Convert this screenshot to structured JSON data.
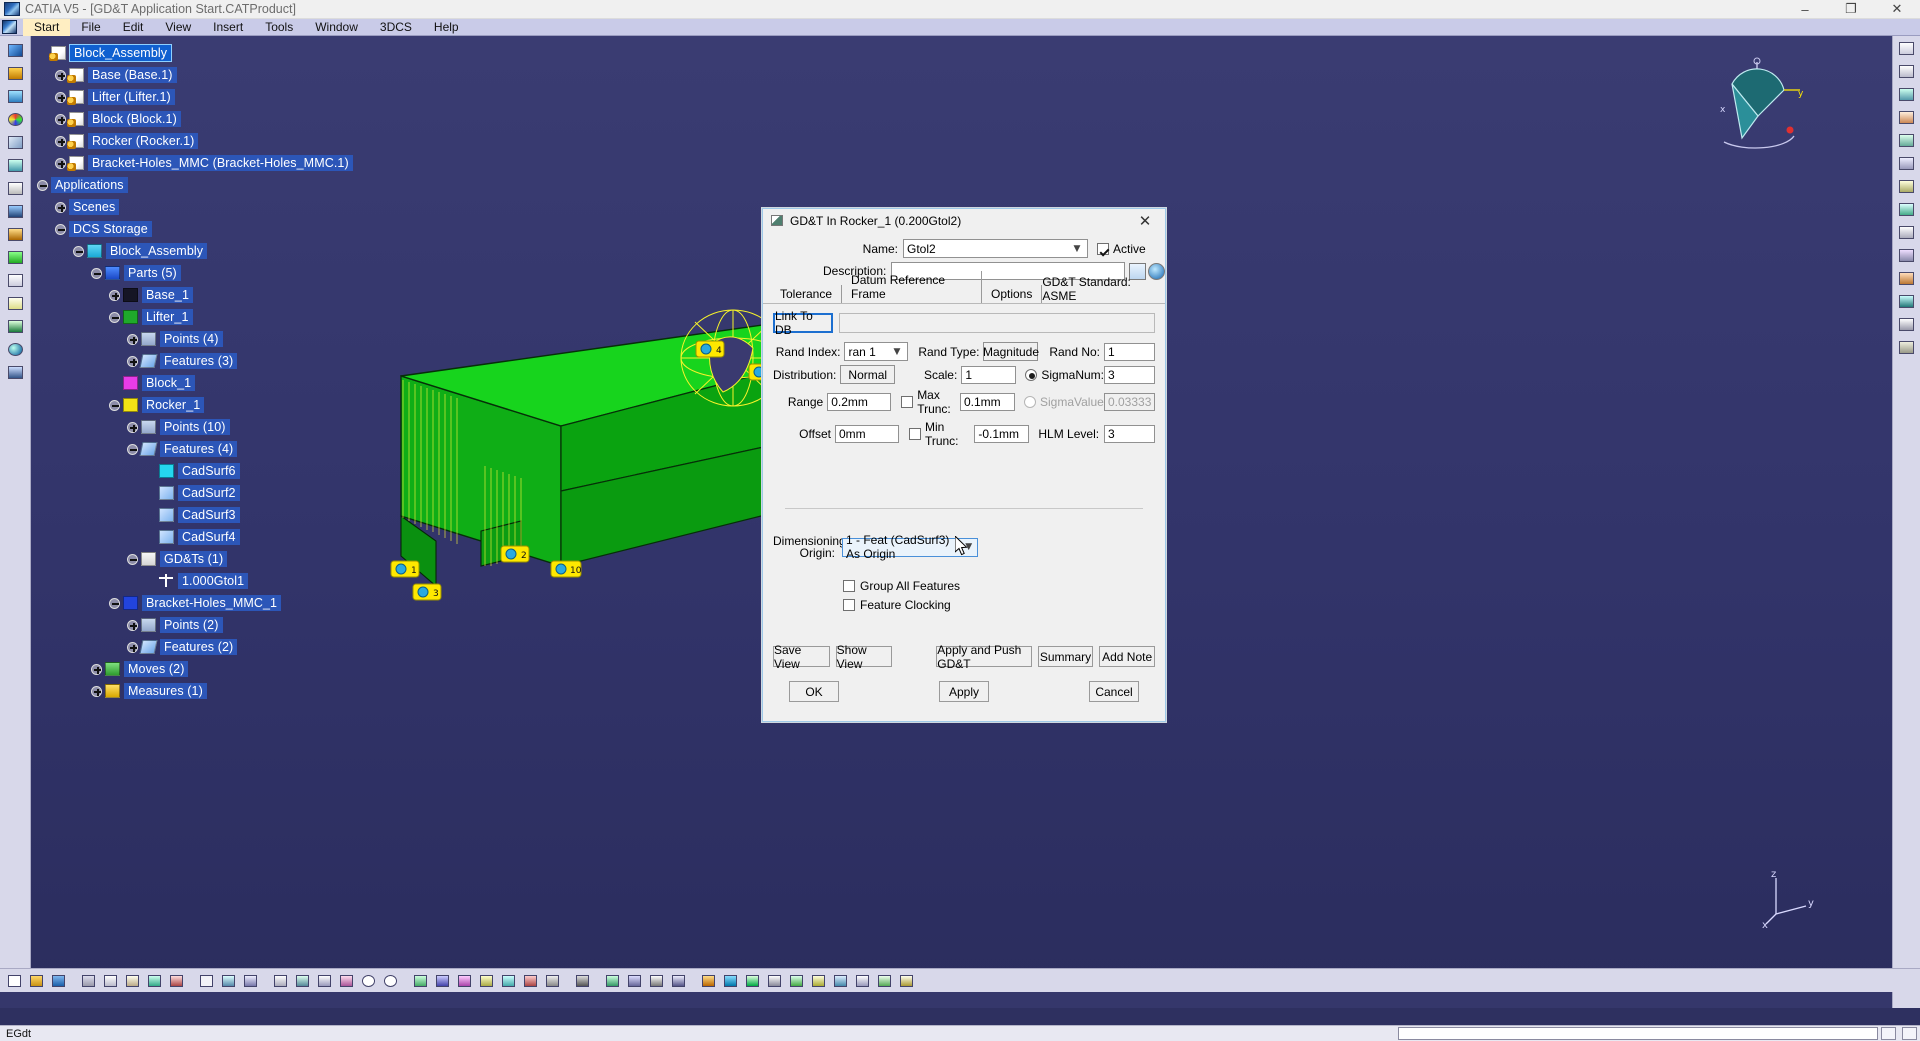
{
  "window": {
    "title": "CATIA V5 - [GD&T Application Start.CATProduct]",
    "minimize": "–",
    "maximize": "❐",
    "close": "✕"
  },
  "menubar": {
    "items": [
      "Start",
      "File",
      "Edit",
      "View",
      "Insert",
      "Tools",
      "Window",
      "3DCS",
      "Help"
    ]
  },
  "tree": {
    "nodes": [
      {
        "label": "Block_Assembly",
        "indent": 0,
        "icon": "document-icon",
        "toggle": "none",
        "state": "selected"
      },
      {
        "label": "Base (Base.1)",
        "indent": 1,
        "icon": "document-icon",
        "toggle": "plus",
        "state": "normal"
      },
      {
        "label": "Lifter (Lifter.1)",
        "indent": 1,
        "icon": "document-icon",
        "toggle": "plus",
        "state": "normal"
      },
      {
        "label": "Block (Block.1)",
        "indent": 1,
        "icon": "document-icon",
        "toggle": "plus",
        "state": "normal"
      },
      {
        "label": "Rocker (Rocker.1)",
        "indent": 1,
        "icon": "document-icon",
        "toggle": "plus",
        "state": "normal"
      },
      {
        "label": "Bracket-Holes_MMC (Bracket-Holes_MMC.1)",
        "indent": 1,
        "icon": "document-icon",
        "toggle": "plus",
        "state": "normal"
      },
      {
        "label": "Applications",
        "indent": 0,
        "icon": "none",
        "toggle": "minus",
        "state": "normal"
      },
      {
        "label": "Scenes",
        "indent": 1,
        "icon": "none",
        "toggle": "plus",
        "state": "normal"
      },
      {
        "label": "DCS Storage",
        "indent": 1,
        "icon": "none",
        "toggle": "minus",
        "state": "normal"
      },
      {
        "label": "Block_Assembly",
        "indent": 2,
        "icon": "assembly-icon",
        "toggle": "minus",
        "state": "normal"
      },
      {
        "label": "Parts (5)",
        "indent": 3,
        "icon": "parts-icon",
        "toggle": "minus",
        "state": "normal"
      },
      {
        "label": "Base_1",
        "indent": 4,
        "icon": "part-black-icon",
        "toggle": "plus",
        "state": "normal"
      },
      {
        "label": "Lifter_1",
        "indent": 4,
        "icon": "part-green-icon",
        "toggle": "minus",
        "state": "normal"
      },
      {
        "label": "Points (4)",
        "indent": 5,
        "icon": "points-icon",
        "toggle": "plus",
        "state": "normal"
      },
      {
        "label": "Features (3)",
        "indent": 5,
        "icon": "features-icon",
        "toggle": "plus",
        "state": "normal"
      },
      {
        "label": "Block_1",
        "indent": 4,
        "icon": "part-magenta-icon",
        "toggle": "none",
        "state": "normal"
      },
      {
        "label": "Rocker_1",
        "indent": 4,
        "icon": "part-yellow-icon",
        "toggle": "minus",
        "state": "normal"
      },
      {
        "label": "Points (10)",
        "indent": 5,
        "icon": "points-icon",
        "toggle": "plus",
        "state": "normal"
      },
      {
        "label": "Features (4)",
        "indent": 5,
        "icon": "features-icon",
        "toggle": "minus",
        "state": "normal"
      },
      {
        "label": "CadSurf6",
        "indent": 6,
        "icon": "cadsurf-hole-icon",
        "toggle": "none",
        "state": "normal"
      },
      {
        "label": "CadSurf2",
        "indent": 6,
        "icon": "cadsurf-icon",
        "toggle": "none",
        "state": "normal"
      },
      {
        "label": "CadSurf3",
        "indent": 6,
        "icon": "cadsurf-icon",
        "toggle": "none",
        "state": "normal"
      },
      {
        "label": "CadSurf4",
        "indent": 6,
        "icon": "cadsurf-icon",
        "toggle": "none",
        "state": "normal"
      },
      {
        "label": "GD&Ts (1)",
        "indent": 5,
        "icon": "gdt-icon",
        "toggle": "minus",
        "state": "normal"
      },
      {
        "label": "1.000Gtol1",
        "indent": 6,
        "icon": "gtol-icon",
        "toggle": "none",
        "state": "normal"
      },
      {
        "label": "Bracket-Holes_MMC_1",
        "indent": 4,
        "icon": "part-blue-icon",
        "toggle": "minus",
        "state": "normal"
      },
      {
        "label": "Points (2)",
        "indent": 5,
        "icon": "points-icon",
        "toggle": "plus",
        "state": "normal"
      },
      {
        "label": "Features (2)",
        "indent": 5,
        "icon": "features-icon",
        "toggle": "plus",
        "state": "normal"
      },
      {
        "label": "Moves (2)",
        "indent": 3,
        "icon": "moves-icon",
        "toggle": "plus",
        "state": "normal"
      },
      {
        "label": "Measures (1)",
        "indent": 3,
        "icon": "measures-icon",
        "toggle": "plus",
        "state": "normal"
      }
    ]
  },
  "viewport": {
    "axis": {
      "x": "x",
      "y": "y",
      "z": "z"
    },
    "part_labels": [
      "4",
      "3",
      "2",
      "10",
      "1"
    ],
    "brand": "CATIA"
  },
  "dialog": {
    "title": "GD&T In Rocker_1 (0.200Gtol2)",
    "close_label": "✕",
    "name_label": "Name:",
    "name_value": "Gtol2",
    "active_label": "Active",
    "active_checked": true,
    "description_label": "Description:",
    "description_value": "",
    "description_placeholder": "",
    "standard_label": "GD&T Standard: ASME",
    "tabs": [
      {
        "label": "Tolerance",
        "active": true
      },
      {
        "label": "Datum Reference Frame",
        "active": false
      },
      {
        "label": "Options",
        "active": false
      }
    ],
    "link_to_db_label": "Link To DB",
    "link_to_db_value": "",
    "rand_index_label": "Rand Index:",
    "rand_index_value": "ran 1",
    "rand_type_label": "Rand Type:",
    "rand_type_value": "Magnitude",
    "rand_no_label": "Rand No:",
    "rand_no_value": "1",
    "distribution_label": "Distribution:",
    "distribution_value": "Normal",
    "scale_label": "Scale:",
    "scale_value": "1",
    "sigma_num_label": "SigmaNum:",
    "sigma_num_value": "3",
    "sigma_num_selected": true,
    "sigma_value_label": "SigmaValue:",
    "sigma_value_value": "0.033333",
    "sigma_value_selected": false,
    "range_label": "Range",
    "range_value": "0.2mm",
    "max_trunc_label": "Max Trunc:",
    "max_trunc_value": "0.1mm",
    "max_trunc_checked": false,
    "hlm_level_label": "HLM Level:",
    "hlm_level_value": "3",
    "offset_label": "Offset",
    "offset_value": "0mm",
    "min_trunc_label": "Min Trunc:",
    "min_trunc_value": "-0.1mm",
    "min_trunc_checked": false,
    "dimensioning_origin_label_line1": "Dimensioning",
    "dimensioning_origin_label_line2": "Origin:",
    "dimensioning_origin_value": "1 - Feat (CadSurf3) As Origin",
    "group_all_features_label": "Group All Features",
    "group_all_features_checked": false,
    "feature_clocking_label": "Feature Clocking",
    "feature_clocking_checked": false,
    "save_view_label": "Save View",
    "show_view_label": "Show View",
    "apply_push_label": "Apply and Push GD&T",
    "summary_label": "Summary",
    "add_note_label": "Add Note",
    "ok_label": "OK",
    "apply_label": "Apply",
    "cancel_label": "Cancel"
  },
  "statusbar": {
    "text": "EGdt",
    "field_value": ""
  },
  "colors": {
    "desktop": "#35376b",
    "tree_text": "#ffffff",
    "selection": "#1060d0",
    "dialog_bg": "#f0f0f0",
    "accent_blue": "#1c6fd0",
    "part_green": "#12cc18",
    "highlight_yellow": "#ffe800"
  }
}
